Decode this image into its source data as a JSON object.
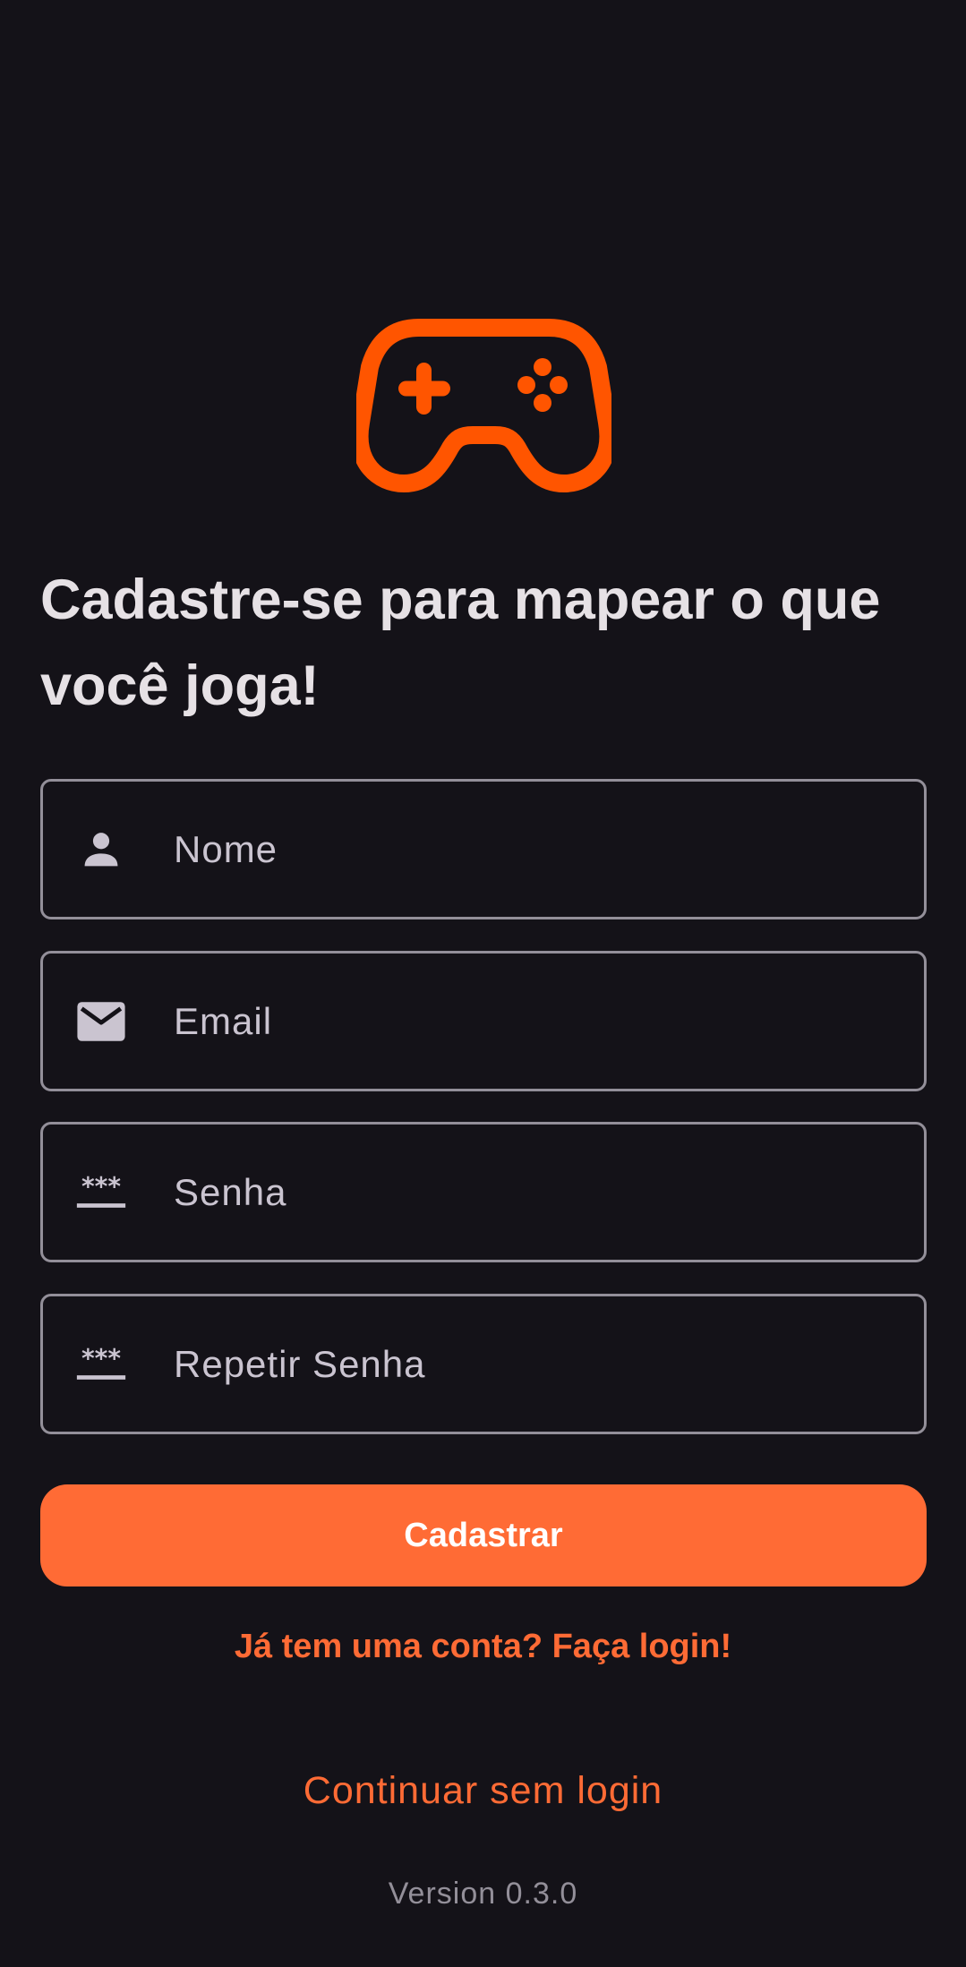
{
  "headline": "Cadastre-se para mapear o que você joga!",
  "form": {
    "name": {
      "placeholder": "Nome",
      "value": "",
      "icon": "person-icon"
    },
    "email": {
      "placeholder": "Email",
      "value": "",
      "icon": "mail-icon"
    },
    "password": {
      "placeholder": "Senha",
      "value": "",
      "icon": "password-icon"
    },
    "repeat_password": {
      "placeholder": "Repetir Senha",
      "value": "",
      "icon": "password-icon"
    }
  },
  "actions": {
    "register_label": "Cadastrar",
    "login_link": "Já tem uma conta? Faça login!",
    "skip_login": "Continuar sem login"
  },
  "version": "Version 0.3.0",
  "colors": {
    "background": "#141218",
    "accent": "#FF6B35",
    "logo": "#FF5500",
    "text_primary": "#E6E1E5",
    "outline": "#938F99",
    "icon": "#CAC4D0"
  },
  "logo_icon": "gamepad-icon"
}
